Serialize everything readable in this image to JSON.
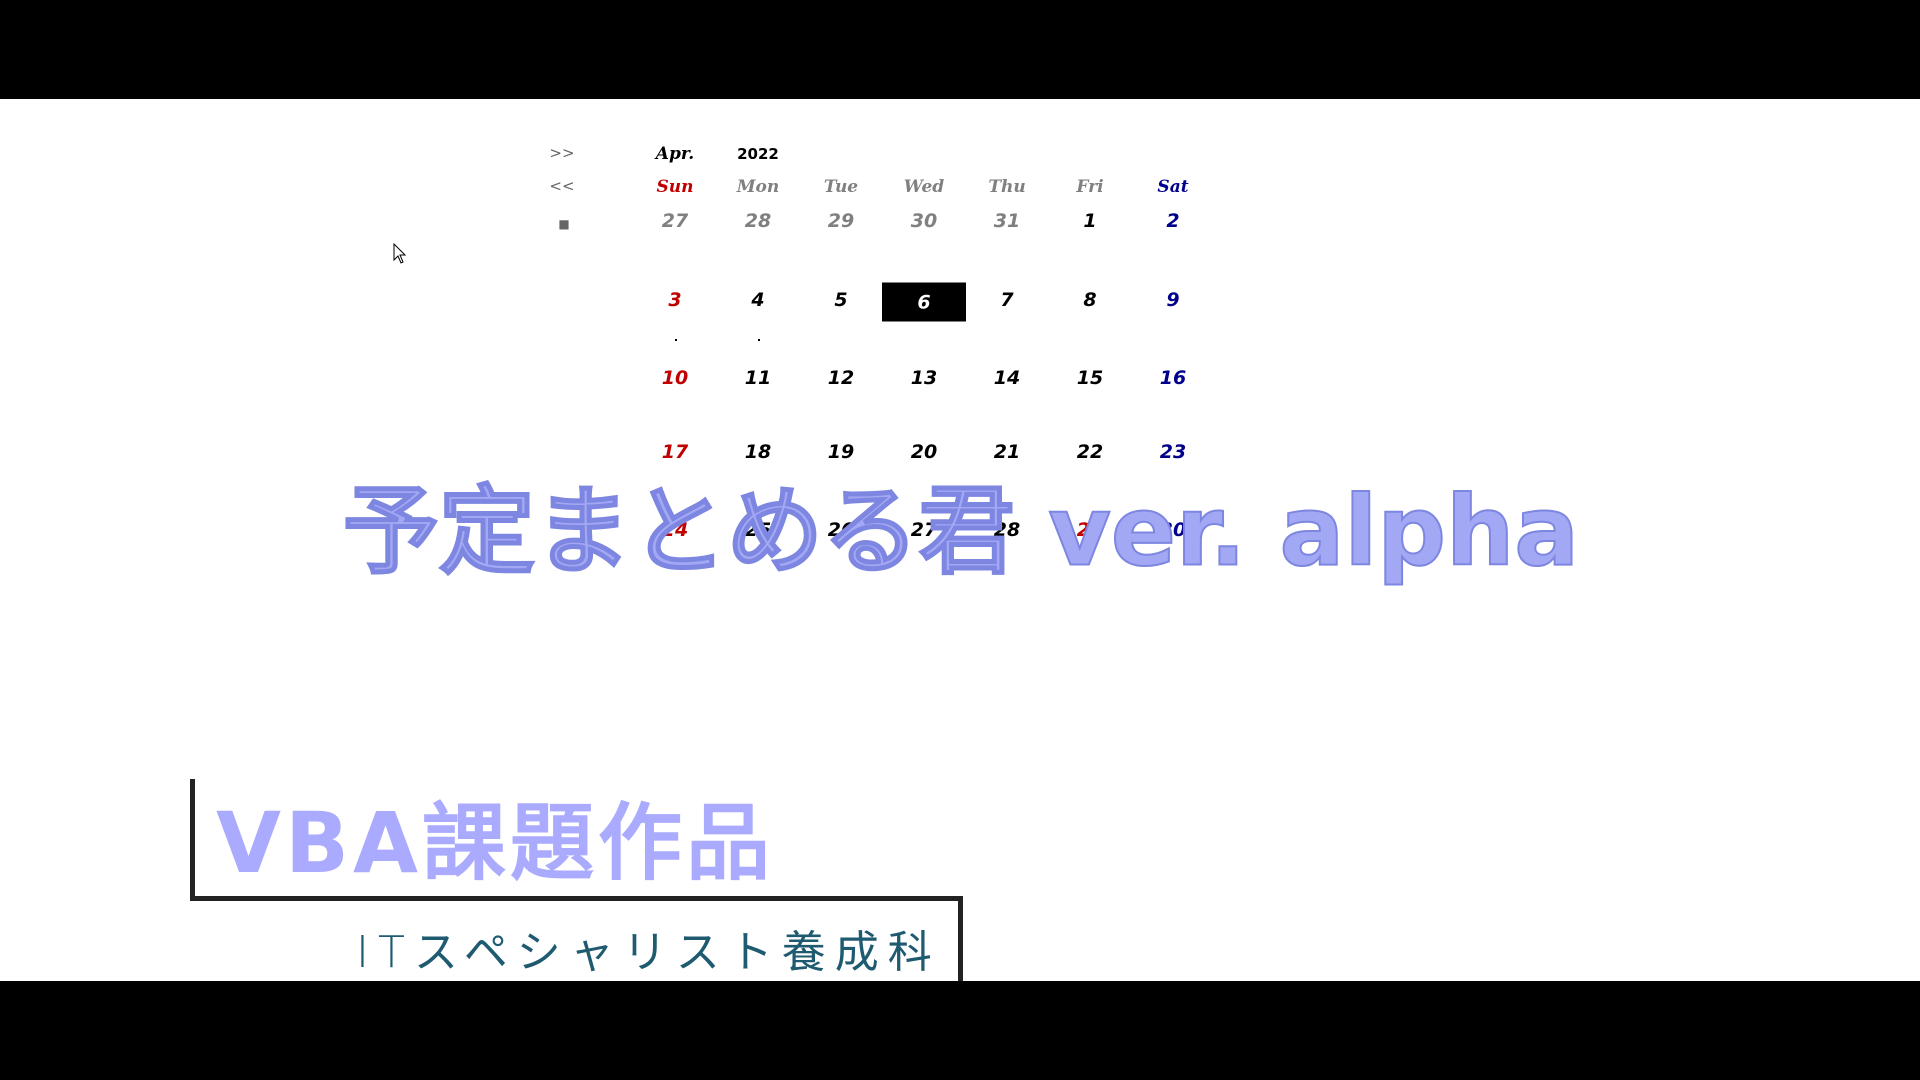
{
  "calendar": {
    "nav": {
      "next": ">>",
      "prev": "<<",
      "today": "■"
    },
    "month": "Apr.",
    "year": "2022",
    "weekdays": [
      "Sun",
      "Mon",
      "Tue",
      "Wed",
      "Thu",
      "Fri",
      "Sat"
    ],
    "selected_day": "6",
    "weeks": [
      [
        {
          "d": "27",
          "c": "gray"
        },
        {
          "d": "28",
          "c": "gray"
        },
        {
          "d": "29",
          "c": "gray"
        },
        {
          "d": "30",
          "c": "gray"
        },
        {
          "d": "31",
          "c": "gray"
        },
        {
          "d": "1",
          "c": "black"
        },
        {
          "d": "2",
          "c": "blue"
        }
      ],
      [
        {
          "d": "3",
          "c": "red"
        },
        {
          "d": "4",
          "c": "black"
        },
        {
          "d": "5",
          "c": "black"
        },
        {
          "d": "6",
          "c": "selected"
        },
        {
          "d": "7",
          "c": "black"
        },
        {
          "d": "8",
          "c": "black"
        },
        {
          "d": "9",
          "c": "blue"
        }
      ],
      [
        {
          "d": "10",
          "c": "red"
        },
        {
          "d": "11",
          "c": "black"
        },
        {
          "d": "12",
          "c": "black"
        },
        {
          "d": "13",
          "c": "black"
        },
        {
          "d": "14",
          "c": "black"
        },
        {
          "d": "15",
          "c": "black"
        },
        {
          "d": "16",
          "c": "blue"
        }
      ],
      [
        {
          "d": "17",
          "c": "red"
        },
        {
          "d": "18",
          "c": "black"
        },
        {
          "d": "19",
          "c": "black"
        },
        {
          "d": "20",
          "c": "black"
        },
        {
          "d": "21",
          "c": "black"
        },
        {
          "d": "22",
          "c": "black"
        },
        {
          "d": "23",
          "c": "blue"
        }
      ],
      [
        {
          "d": "24",
          "c": "red"
        },
        {
          "d": "25",
          "c": "black"
        },
        {
          "d": "26",
          "c": "black"
        },
        {
          "d": "27",
          "c": "black"
        },
        {
          "d": "28",
          "c": "black"
        },
        {
          "d": "29",
          "c": "red"
        },
        {
          "d": "30",
          "c": "blue"
        }
      ]
    ],
    "colors": {
      "sunday": "#c00000",
      "saturday": "#00008b",
      "other_month": "#808080",
      "selected_bg": "#000000"
    }
  },
  "overlay_title": "予定まとめる君 ver. alpha",
  "caption": {
    "heading": "VBA課題作品",
    "subheading": "ITスペシャリスト養成科"
  },
  "colors": {
    "title": "#a3a8f5",
    "heading": "#aaaaff",
    "subheading": "#1e5a70"
  }
}
